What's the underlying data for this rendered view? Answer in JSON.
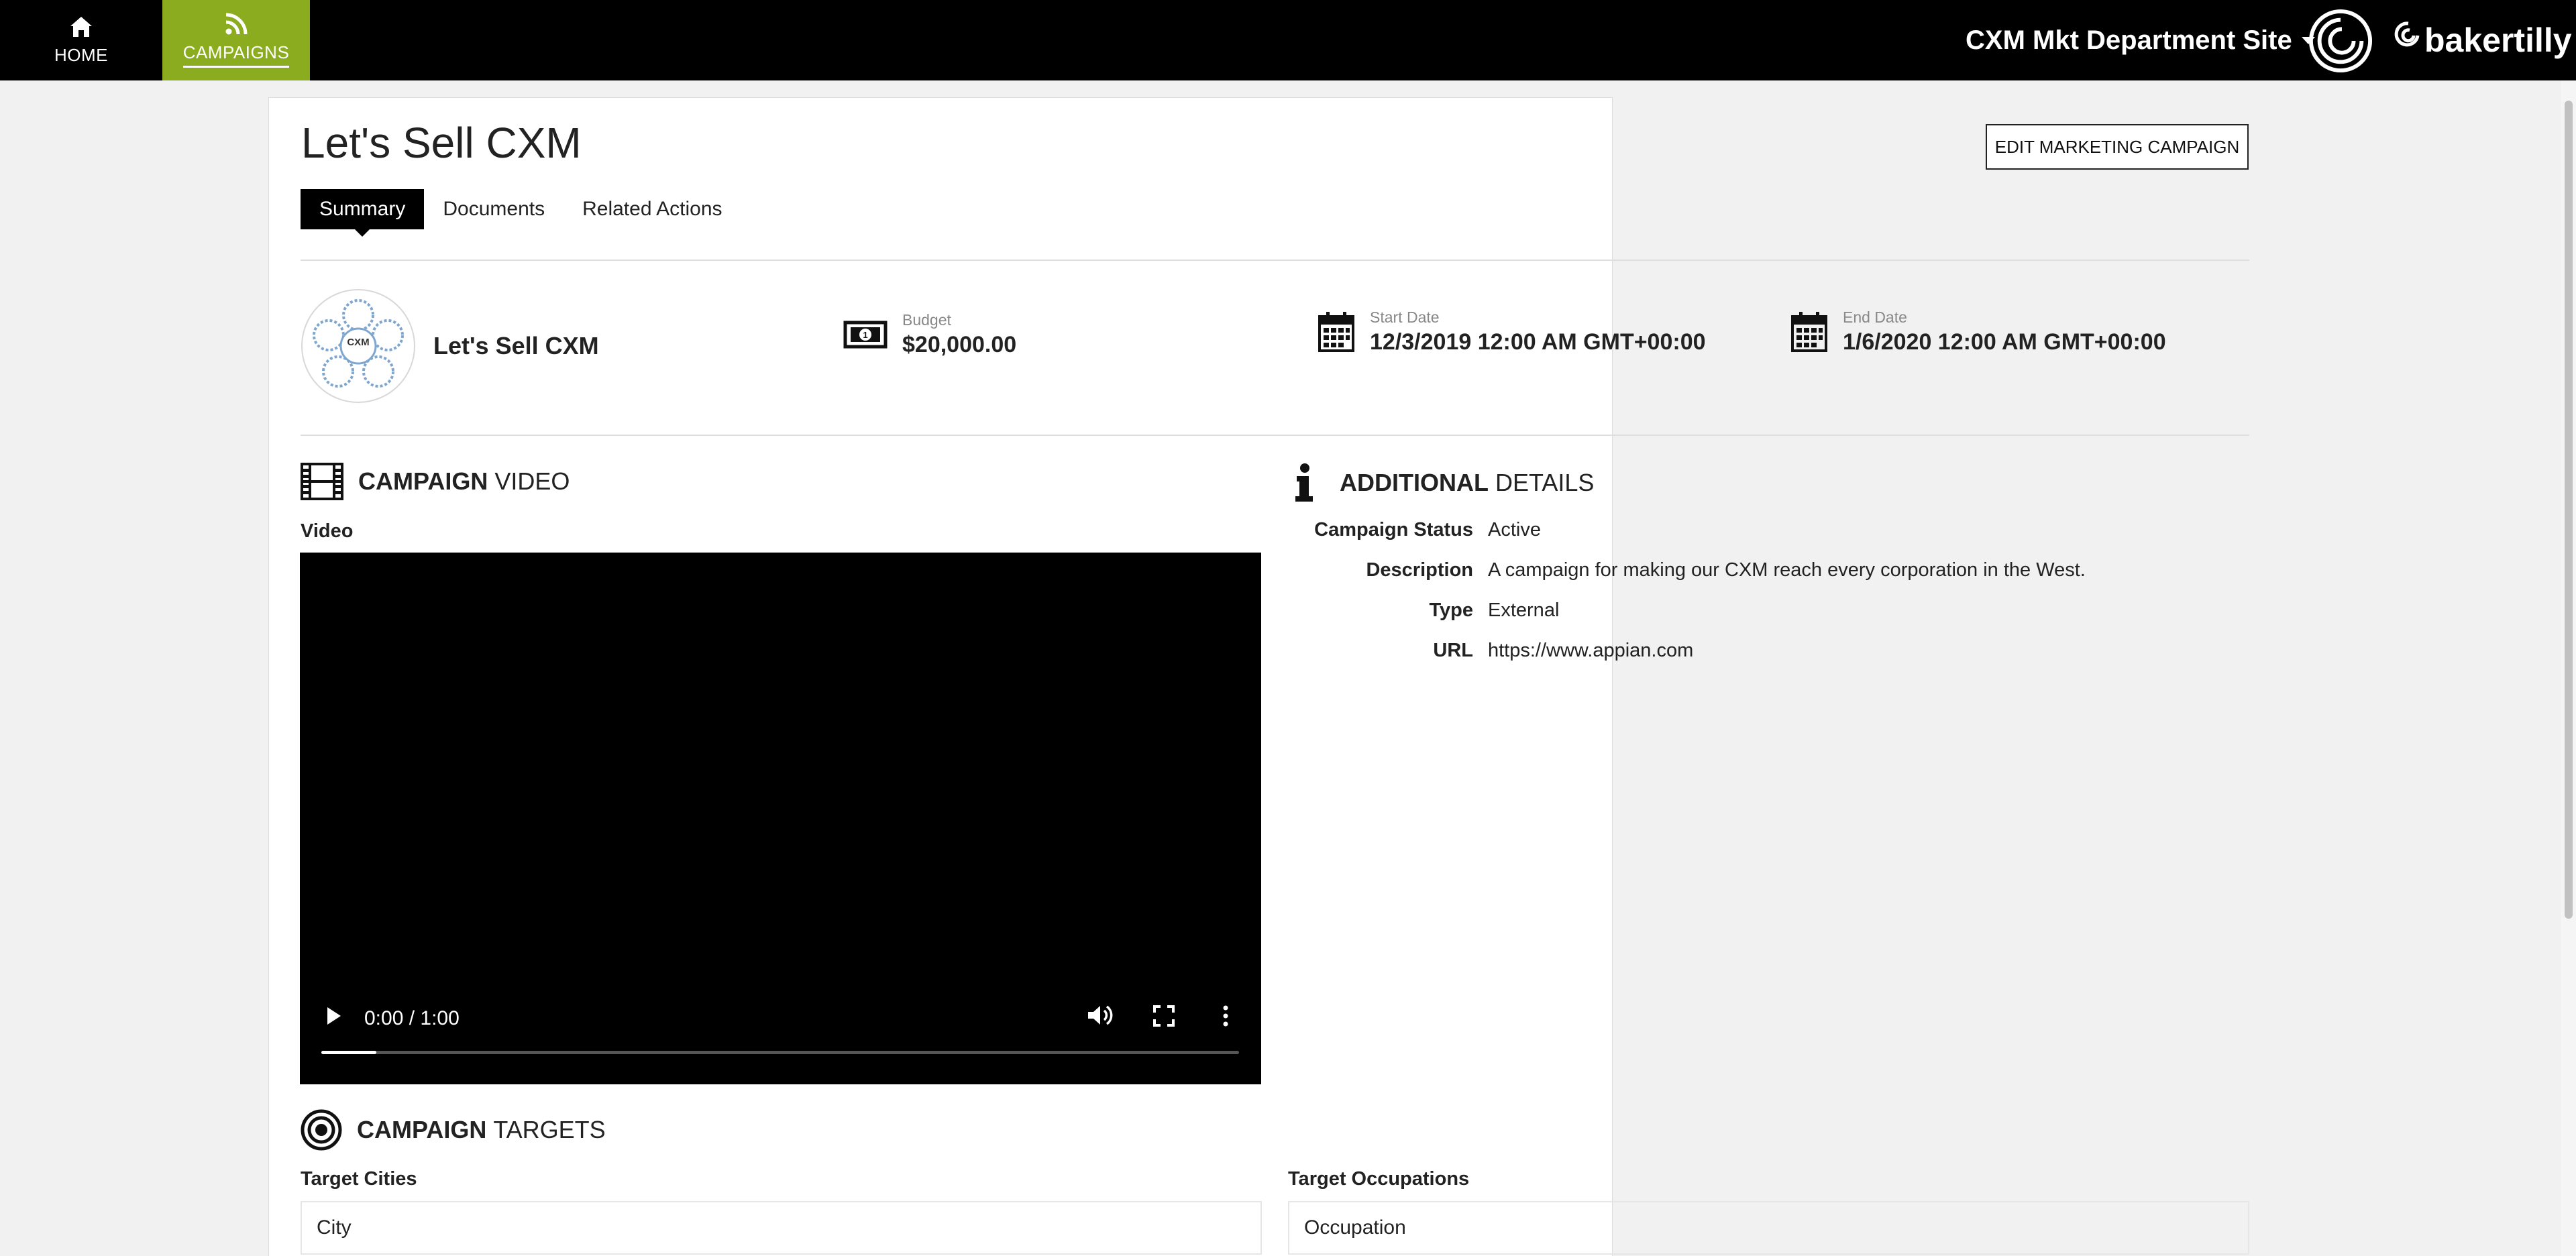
{
  "nav": {
    "home_label": "HOME",
    "campaigns_label": "CAMPAIGNS",
    "site_name": "CXM Mkt Department Site",
    "brand": "bakertilly",
    "accent_color": "#8aac1e"
  },
  "page": {
    "title": "Let's Sell CXM",
    "edit_button": "EDIT MARKETING CAMPAIGN",
    "tabs": [
      "Summary",
      "Documents",
      "Related Actions"
    ]
  },
  "summary": {
    "campaign_name": "Let's Sell CXM",
    "thumbnail_text": "CXM",
    "budget_label": "Budget",
    "budget_value": "$20,000.00",
    "start_label": "Start Date",
    "start_value": "12/3/2019 12:00 AM GMT+00:00",
    "end_label": "End Date",
    "end_value": "1/6/2020 12:00 AM GMT+00:00"
  },
  "video_section": {
    "title_bold": "CAMPAIGN",
    "title_light": "VIDEO",
    "field_label": "Video",
    "time": "0:00 / 1:00",
    "progress": 0.06
  },
  "details_section": {
    "title_bold": "ADDITIONAL",
    "title_light": "DETAILS",
    "rows": [
      {
        "key": "Campaign Status",
        "value": "Active"
      },
      {
        "key": "Description",
        "value": "A campaign for making our CXM reach every corporation in the West."
      },
      {
        "key": "Type",
        "value": "External"
      },
      {
        "key": "URL",
        "value": "https://www.appian.com"
      }
    ]
  },
  "targets_section": {
    "title_bold": "CAMPAIGN",
    "title_light": "TARGETS",
    "cities_label": "Target Cities",
    "cities_header": "City",
    "occupations_label": "Target Occupations",
    "occupations_header": "Occupation"
  }
}
